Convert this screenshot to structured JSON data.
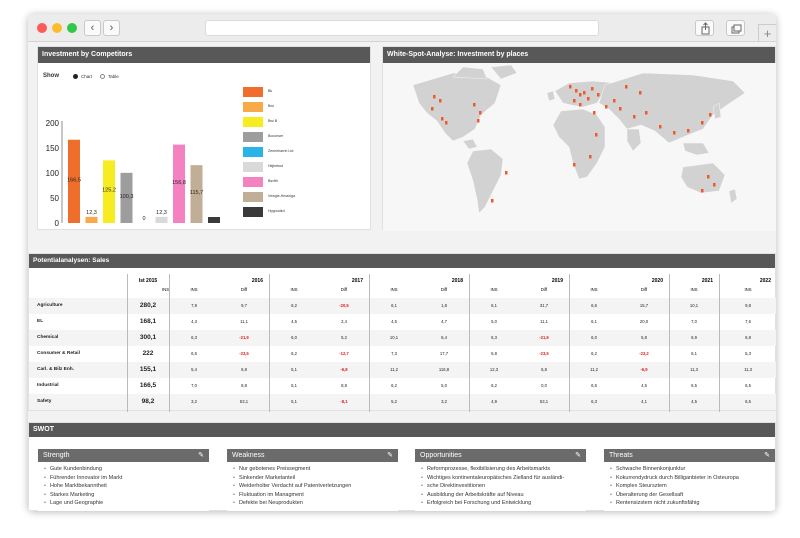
{
  "browser": {
    "back": "‹",
    "forward": "›",
    "new_tab": "+"
  },
  "competitors": {
    "title": "Investment by Competitors",
    "show_label": "Show",
    "options": [
      "Chart",
      "Table"
    ],
    "selected": "Chart",
    "legend": [
      {
        "label": "Bk",
        "color": "#f06e2c"
      },
      {
        "label": "Bwi",
        "color": "#f8a94a"
      },
      {
        "label": "Bwi B",
        "color": "#f7ec1f"
      },
      {
        "label": "Boconser",
        "color": "#9d9d9d"
      },
      {
        "label": "Zeeneharrin Ltd",
        "color": "#28b4e6"
      },
      {
        "label": "Hkjbetsut",
        "color": "#d9d9d9"
      },
      {
        "label": "Bsvfth",
        "color": "#f582c0"
      },
      {
        "label": "Vewgie-Hmaxiga",
        "color": "#c0ae97"
      },
      {
        "label": "Hpgrootkd",
        "color": "#3a3a3a"
      }
    ]
  },
  "chart_data": {
    "type": "bar",
    "yticks": [
      "0",
      "50",
      "100",
      "150",
      "200"
    ],
    "ylim": [
      0,
      200
    ],
    "values": [
      166.5,
      12.3,
      125.2,
      100.3,
      0,
      12.3,
      156.8,
      115.7,
      12
    ],
    "value_labels": [
      "166,5",
      "12,3",
      "125,2",
      "100,3",
      "0",
      "12,3",
      "156,8",
      "115,7",
      ""
    ]
  },
  "map": {
    "title": "White-Spot-Analyse: Investment by places"
  },
  "sales": {
    "title": "Potentialanalysen: Sales",
    "ist_label": "Ist 2015",
    "ins_label": "INS",
    "diff_label": "Diff",
    "years": [
      "2016",
      "2017",
      "2018",
      "2019",
      "2020",
      "2021",
      "2022"
    ],
    "rows": [
      {
        "name": "Agriculture",
        "ist": "280,2",
        "cells": [
          "7,9",
          "9,7",
          "6,2",
          "-20,5",
          "6,1",
          "1,8",
          "6,1",
          "31,7",
          "6,6",
          "15,7",
          "10,1",
          "9,8"
        ]
      },
      {
        "name": "EL",
        "ist": "168,1",
        "cells": [
          "4,3",
          "11,1",
          "4,5",
          "2,4",
          "4,5",
          "4,7",
          "5,0",
          "11,1",
          "6,1",
          "20,0",
          "7,0",
          "7,6"
        ]
      },
      {
        "name": "Chemical",
        "ist": "300,1",
        "cells": [
          "6,3",
          "-21,9",
          "6,0",
          "5,2",
          "10,1",
          "6,4",
          "6,3",
          "-21,9",
          "6,0",
          "5,8",
          "6,9",
          "6,8"
        ]
      },
      {
        "name": "Consumer & Retail",
        "ist": "222",
        "cells": [
          "6,5",
          "-23,5",
          "6,2",
          "-12,7",
          "7,3",
          "17,7",
          "5,8",
          "-23,5",
          "6,2",
          "-23,2",
          "6,1",
          "5,3"
        ]
      },
      {
        "name": "Carl. & Bilz Enh.",
        "ist": "155,1",
        "cells": [
          "5,4",
          "6,8",
          "5,1",
          "-6,8",
          "11,2",
          "116,8",
          "12,3",
          "6,8",
          "11,2",
          "-6,9",
          "11,3",
          "11,3"
        ]
      },
      {
        "name": "Industrial",
        "ist": "166,5",
        "cells": [
          "7,0",
          "8,8",
          "5,1",
          "8,8",
          "6,2",
          "5,0",
          "6,2",
          "0,0",
          "6,5",
          "4,5",
          "6,5",
          "6,5"
        ]
      },
      {
        "name": "Safety",
        "ist": "98,2",
        "cells": [
          "3,2",
          "53,1",
          "5,1",
          "-8,1",
          "5,2",
          "3,2",
          "4,9",
          "53,1",
          "6,3",
          "4,1",
          "4,5",
          "6,5"
        ]
      }
    ],
    "ist_sub": "INS"
  },
  "swot": {
    "title": "SWOT",
    "quadrants": [
      {
        "title": "Strength",
        "items": [
          "Gute Kundenbindung",
          "Führender Innovator im Markt",
          "Hohe Marktbekanntheit",
          "Starkes Marketing",
          "Lage und Geographie"
        ]
      },
      {
        "title": "Weakness",
        "items": [
          "Nur gebotenes Preissegment",
          "Sinkender Marketanteil",
          "Weiderholter Verdacht auf Patentverletzungen",
          "Fluktuation im Managment",
          "Defekte bei Neuprodukten"
        ]
      },
      {
        "title": "Opportunities",
        "items": [
          "Reformprozesse, flexibilisierung des Arbeitsmarkts",
          "Wichtiges kontinentaleuropäisches Zielland für ausländi-",
          "sche Direktinvestitionen",
          "Ausbildung der Arbeitskräfte auf Niveau",
          "Erfolgreich bei Forschung und Entwicklung"
        ]
      },
      {
        "title": "Threats",
        "items": [
          "Schwache Binnenkonjunktur",
          "Kokurrendydruck durch Billiganbieter in Osteuropa",
          "Komplex Steursztem",
          "Überalterung der Gesellsaft",
          "Rentensizstem nicht zukunftsfähig"
        ]
      }
    ]
  }
}
